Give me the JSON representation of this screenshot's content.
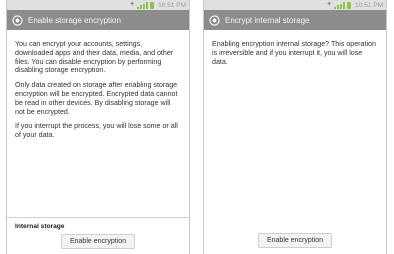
{
  "left_screen": {
    "status_time": "10:51 PM",
    "title": "Enable storage encryption",
    "paragraphs": [
      "You can encrypt your accounts, settings, downloaded apps and their data, media, and other files. You can disable encryption by performing disabling storage encryption.",
      "Only data created on storage after enabling storage encryption will be encrypted. Encrypted data cannot be read in other devices. By disabling storage will not be encrypted.",
      "If you interrupt the process, you will lose some or all of your data."
    ],
    "section_label": "Internal storage",
    "button_label": "Enable encryption"
  },
  "right_screen": {
    "status_time": "10:51 PM",
    "title": "Encrypt internal storage",
    "paragraphs": [
      "Enabling encryption internal storage? This operation is irreversible and if you interrupt it, you will lose data."
    ],
    "button_label": "Enable encryption"
  },
  "icons": {
    "title_icon": "settings-icon",
    "status_icons": [
      "nfc-icon",
      "signal-icon",
      "battery-icon"
    ]
  },
  "colors": {
    "titlebar": "#8c8c8c",
    "statusbar": "#e0e0e0",
    "signal": "#8fc24a"
  }
}
